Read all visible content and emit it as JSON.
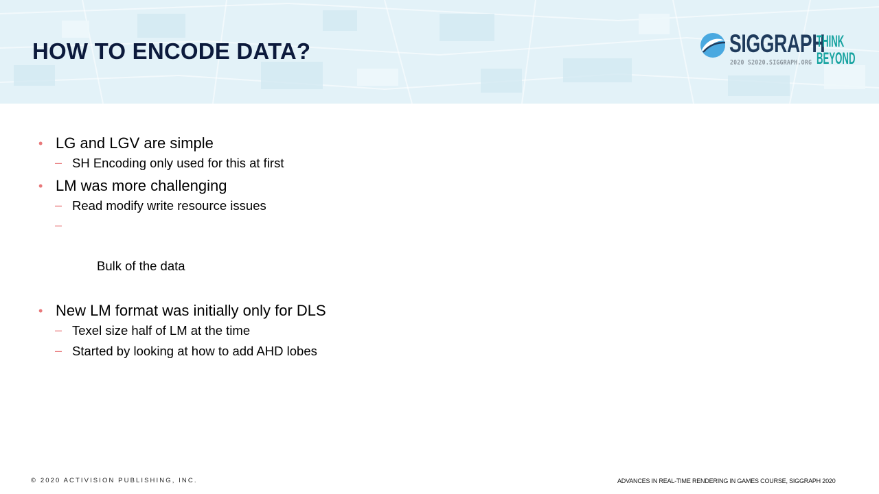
{
  "slide": {
    "title": "HOW TO ENCODE DATA?",
    "colors": {
      "header_bg": "#e3f2f8",
      "title": "#0c1a3c",
      "bullet_marker": "#e8787a",
      "logo_navy": "#1f3b5c",
      "logo_blue": "#4aa9e0",
      "logo_teal": "#17a3a0"
    }
  },
  "logo": {
    "icon": "siggraph-swirl-icon",
    "wordmark": "SIGGRAPH",
    "subline": "2020  S2020.SIGGRAPH.ORG",
    "tagline_line1": "THINK",
    "tagline_line2": "BEYOND"
  },
  "bullets": [
    {
      "text": "LG and LGV are simple",
      "subs": [
        "SH Encoding only used for this at first"
      ]
    },
    {
      "text": "LM was more challenging",
      "subs": [
        "Read modify write resource issues",
        " Bulk of the data"
      ]
    },
    {
      "text": "New LM format was initially only for DLS",
      "subs": [
        "Texel size half of LM at the time",
        "Started by looking at how to add AHD lobes"
      ]
    }
  ],
  "markers": {
    "level1": "•",
    "level2": "–"
  },
  "footer": {
    "left": "© 2020 ACTIVISION PUBLISHING, INC.",
    "right": "ADVANCES IN REAL-TIME RENDERING IN GAMES COURSE, SIGGRAPH 2020"
  }
}
